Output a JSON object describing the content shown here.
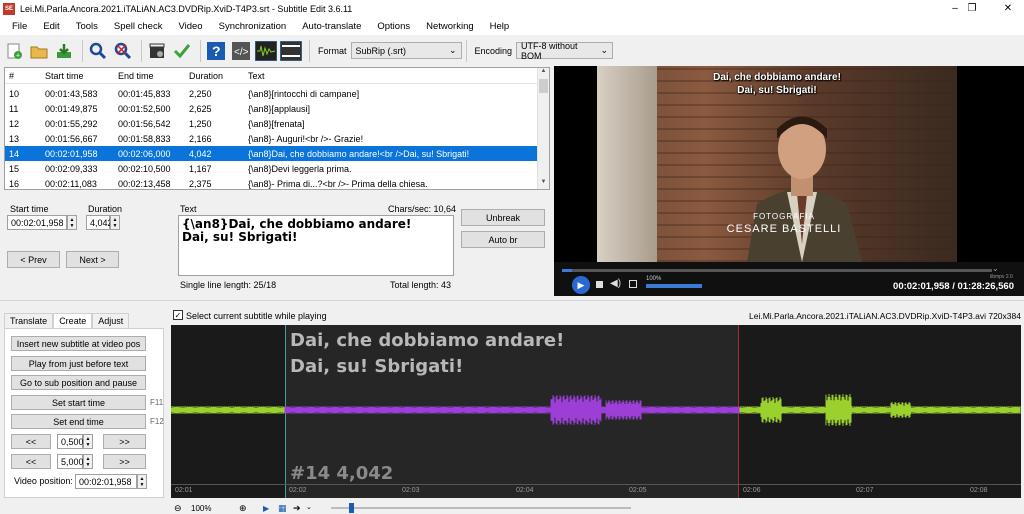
{
  "window": {
    "title": "Lei.Mi.Parla.Ancora.2021.iTALiAN.AC3.DVDRip.XviD-T4P3.srt - Subtitle Edit 3.6.11",
    "app_icon": "SE",
    "minimize": "–",
    "maximize": "❐",
    "close": "✕"
  },
  "menu": [
    "File",
    "Edit",
    "Tools",
    "Spell check",
    "Video",
    "Synchronization",
    "Auto-translate",
    "Options",
    "Networking",
    "Help"
  ],
  "toolbar": {
    "format_label": "Format",
    "format_value": "SubRip (.srt)",
    "encoding_label": "Encoding",
    "encoding_value": "UTF-8 without BOM"
  },
  "grid": {
    "headers": [
      "#",
      "Start time",
      "End time",
      "Duration",
      "Text"
    ],
    "rows": [
      {
        "n": "10",
        "start": "00:01:43,583",
        "end": "00:01:45,833",
        "dur": "2,250",
        "text": "{\\an8}[rintocchi di campane]"
      },
      {
        "n": "11",
        "start": "00:01:49,875",
        "end": "00:01:52,500",
        "dur": "2,625",
        "text": "{\\an8}[applausi]"
      },
      {
        "n": "12",
        "start": "00:01:55,292",
        "end": "00:01:56,542",
        "dur": "1,250",
        "text": "{\\an8}[frenata]"
      },
      {
        "n": "13",
        "start": "00:01:56,667",
        "end": "00:01:58,833",
        "dur": "2,166",
        "text": "{\\an8}- Auguri!<br />- Grazie!"
      },
      {
        "n": "14",
        "start": "00:02:01,958",
        "end": "00:02:06,000",
        "dur": "4,042",
        "text": "{\\an8}Dai, che dobbiamo andare!<br />Dai, su! Sbrigati!"
      },
      {
        "n": "15",
        "start": "00:02:09,333",
        "end": "00:02:10,500",
        "dur": "1,167",
        "text": "{\\an8}Devi leggerla prima."
      },
      {
        "n": "16",
        "start": "00:02:11,083",
        "end": "00:02:13,458",
        "dur": "2,375",
        "text": "{\\an8}- Prima di...?<br />- Prima della chiesa."
      }
    ],
    "selected_index": 4
  },
  "editor": {
    "start_label": "Start time",
    "start_value": "00:02:01,958",
    "duration_label": "Duration",
    "duration_value": "4,042",
    "prev": "< Prev",
    "next": "Next >",
    "text_label": "Text",
    "chars_sec": "Chars/sec: 10,64",
    "text_line1": "{\\an8}Dai, che dobbiamo andare!",
    "text_line2": "Dai, su! Sbrigati!",
    "single_line_length": "Single line length: 25/18",
    "total_length": "Total length: 43",
    "unbreak": "Unbreak",
    "auto_br": "Auto br"
  },
  "video": {
    "sub_line1": "Dai, che dobbiamo andare!",
    "sub_line2": "Dai, su! Sbrigati!",
    "credit1": "FOTOGRAFIA",
    "credit2": "CESARE BASTELLI",
    "volume": "100%",
    "player": "libmpv 2.0",
    "time": "00:02:01,958 / 01:28:26,560",
    "volume_level": 1.0,
    "position_fraction": 0.023
  },
  "tabs": [
    "Translate",
    "Create",
    "Adjust"
  ],
  "create": {
    "insert": "Insert new subtitle at video pos",
    "play_before": "Play from just before text",
    "goto": "Go to sub position and pause",
    "set_start": "Set start time",
    "set_start_key": "F11",
    "set_end": "Set end time",
    "set_end_key": "F12",
    "back": "<<",
    "fwd": ">>",
    "step1": "0,500",
    "step2": "5,000",
    "video_pos_label": "Video position:",
    "video_pos_value": "00:02:01,958"
  },
  "waveform": {
    "checkbox_label": "Select current subtitle while playing",
    "checked": "✓",
    "file_info": "Lei.Mi.Parla.Ancora.2021.iTALiAN.AC3.DVDRip.XviD-T4P3.avi 720x384",
    "sub_line1": "Dai, che dobbiamo andare!",
    "sub_line2": "Dai, su! Sbrigati!",
    "sub_number": "#14  4,042",
    "ticks": [
      "02:01",
      "02:02",
      "02:03",
      "02:04",
      "02:05",
      "02:06",
      "02:07",
      "02:08"
    ],
    "zoom": "100%"
  },
  "colors": {
    "selection": "#0a74da",
    "wave_default": "#9ad12f",
    "wave_selected": "#9b3fd6"
  }
}
